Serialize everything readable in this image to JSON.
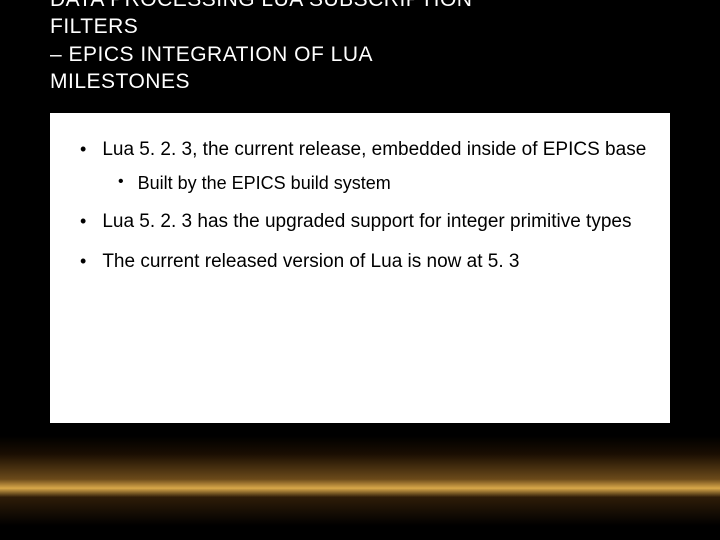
{
  "header": {
    "line1_cut": "DATA PROCESSING LUA SUBSCRIPTION",
    "line2": "FILTERS",
    "line3": "– EPICS INTEGRATION OF LUA",
    "line4": "MILESTONES"
  },
  "bullets": {
    "b1": "Lua 5. 2. 3, the current release, embedded inside of EPICS base",
    "b1a": "Built by the EPICS build system",
    "b2": "Lua 5. 2. 3 has the upgraded support for integer primitive types",
    "b3": "The current released version of Lua is now at 5. 3"
  }
}
